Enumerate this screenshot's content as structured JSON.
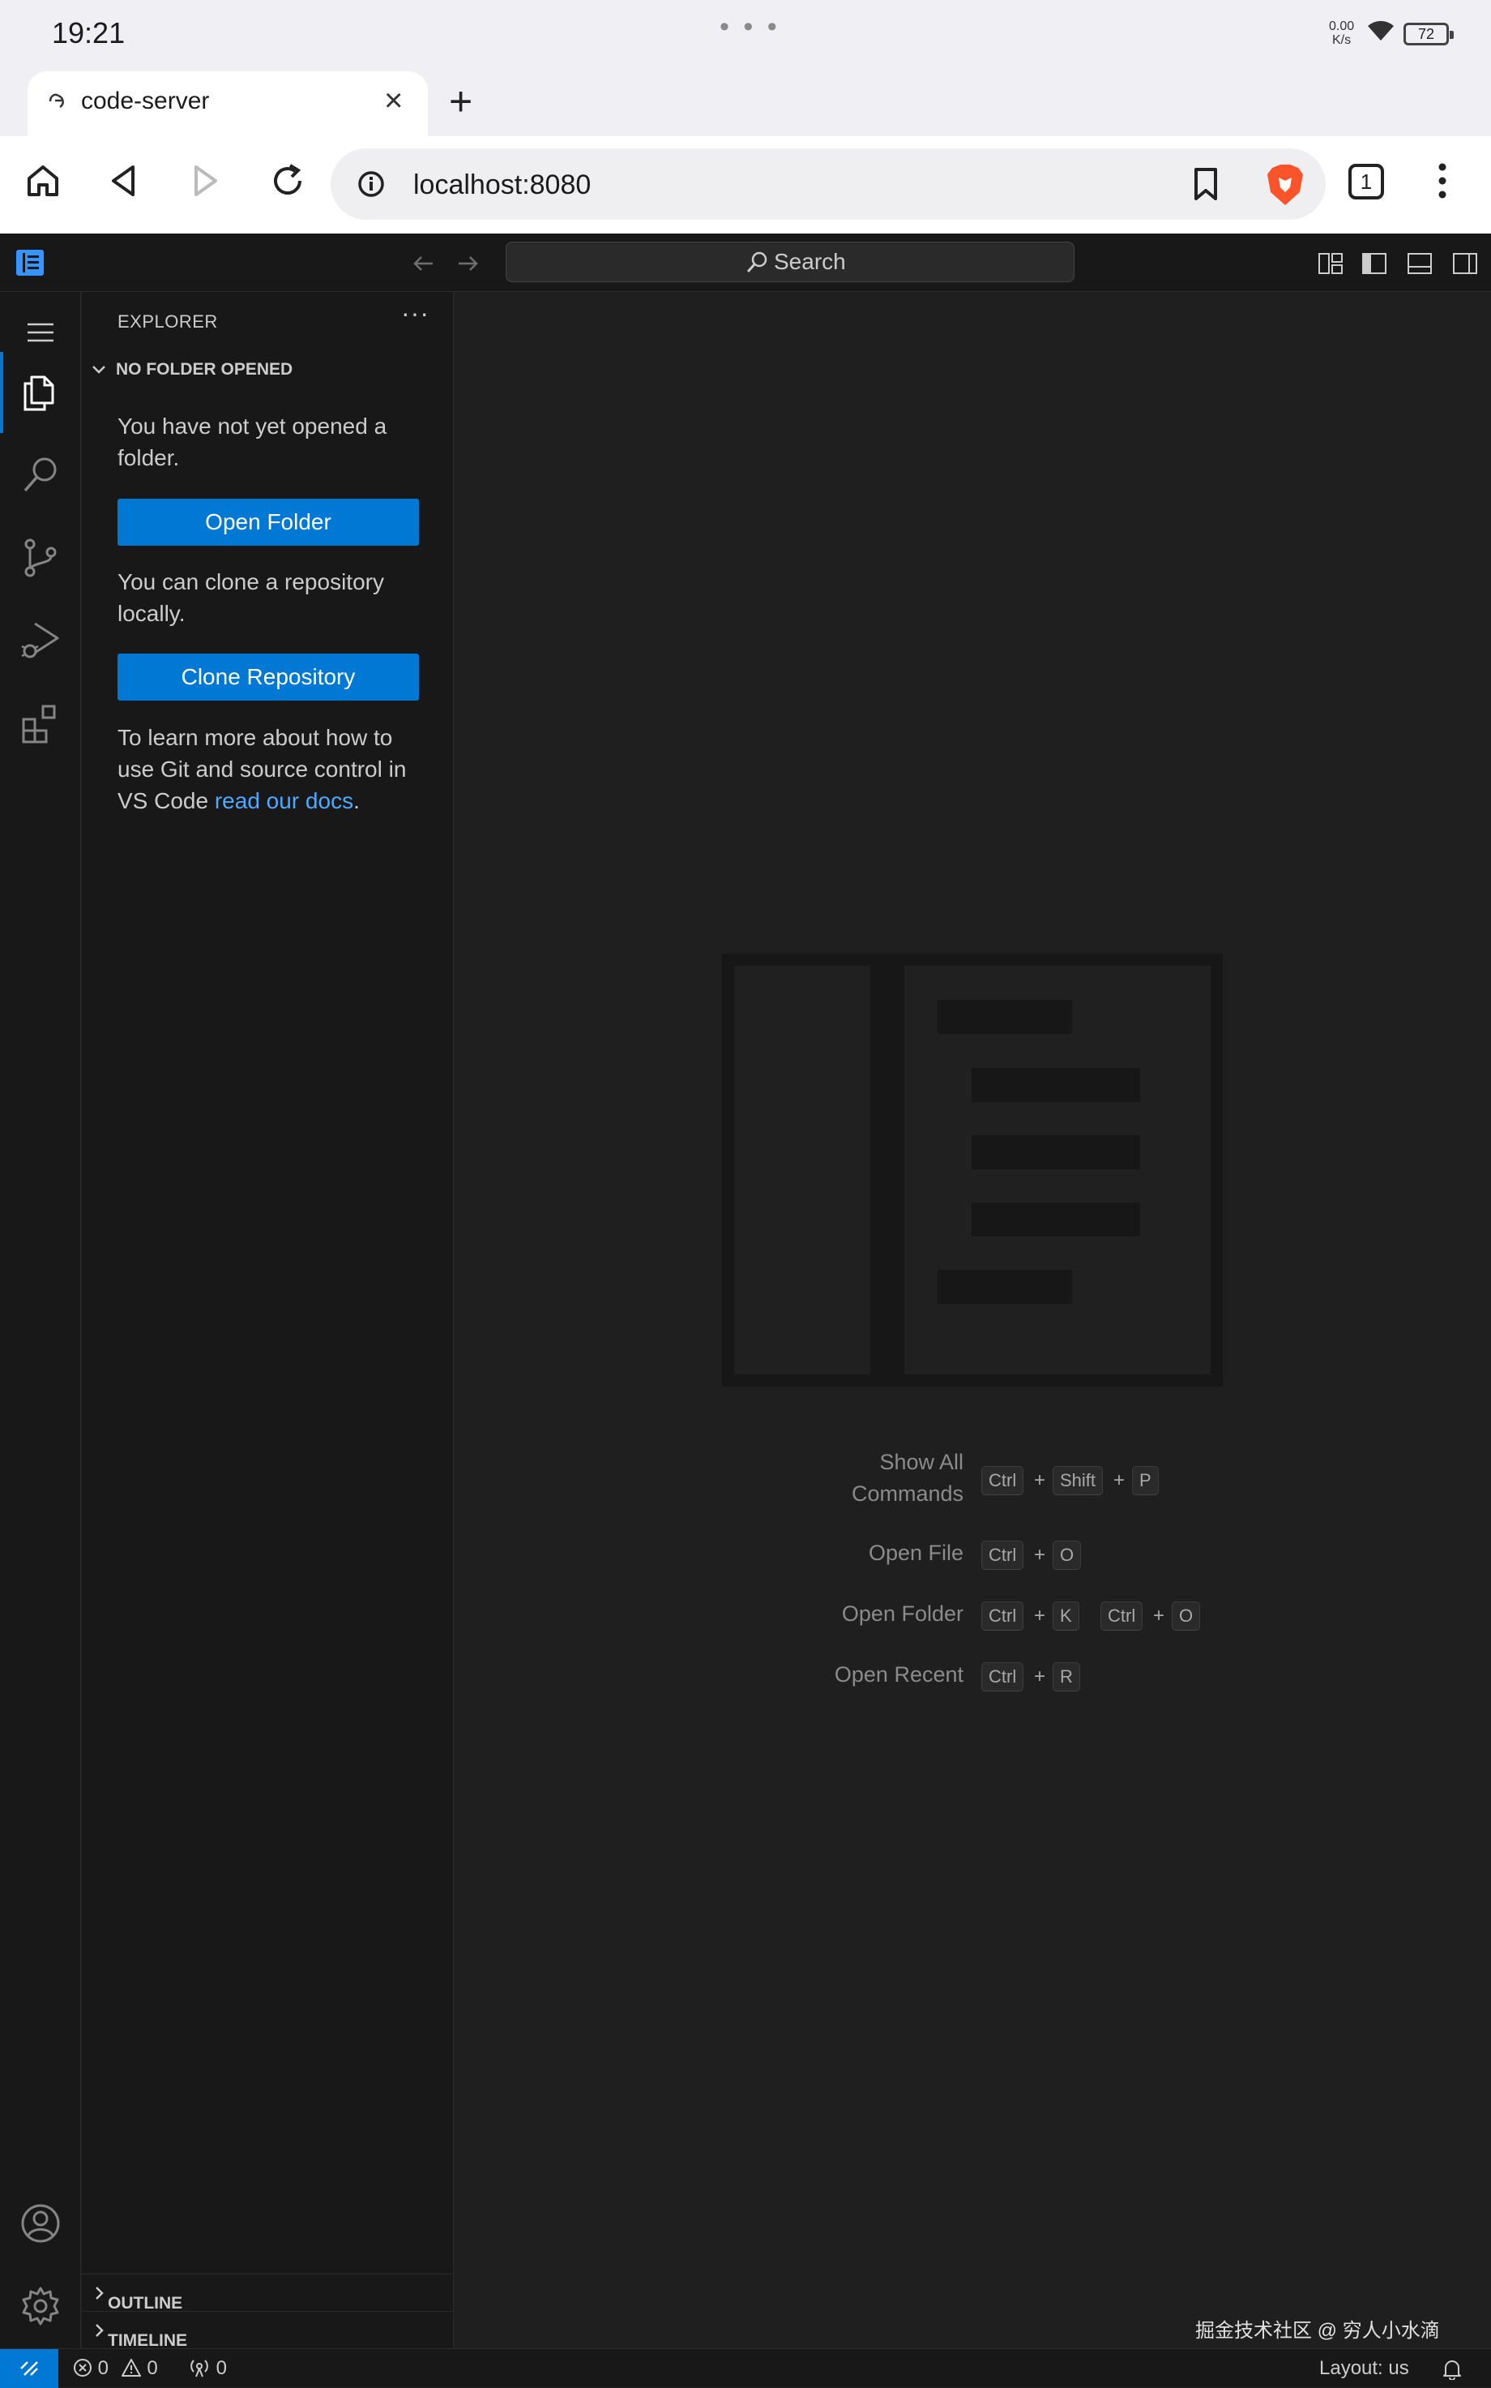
{
  "android_status": {
    "time": "19:21",
    "net_speed_value": "0.00",
    "net_speed_unit": "K/s",
    "battery": "72"
  },
  "browser": {
    "tab_title": "code-server",
    "url": "localhost:8080",
    "tab_count": "1"
  },
  "titlebar": {
    "search_placeholder": "Search"
  },
  "activity_bar": {
    "items": [
      "menu-icon",
      "explorer-icon",
      "search-icon",
      "source-control-icon",
      "run-debug-icon",
      "extensions-icon",
      "account-icon",
      "gear-icon"
    ],
    "active": "explorer"
  },
  "sidebar": {
    "header": "EXPLORER",
    "section_title": "NO FOLDER OPENED",
    "no_folder_text": "You have not yet opened a folder.",
    "open_folder_button": "Open Folder",
    "clone_text": "You can clone a repository locally.",
    "clone_button": "Clone Repository",
    "learn_text_prefix": "To learn more about how to use Git and source control in VS Code ",
    "learn_link": "read our docs",
    "learn_text_suffix": ".",
    "outline_label": "OUTLINE",
    "timeline_label": "TIMELINE"
  },
  "editor": {
    "shortcuts": [
      {
        "label_line1": "Show All",
        "label_line2": "Commands",
        "keys": [
          "Ctrl",
          "Shift",
          "P"
        ]
      },
      {
        "label_line1": "Open File",
        "keys": [
          "Ctrl",
          "O"
        ]
      },
      {
        "label_line1": "Open Folder",
        "keys": [
          "Ctrl",
          "K",
          "Ctrl",
          "O"
        ]
      },
      {
        "label_line1": "Open Recent",
        "keys": [
          "Ctrl",
          "R"
        ]
      }
    ],
    "plus": "+",
    "credit": "掘金技术社区 @ 穷人小水滴"
  },
  "statusbar": {
    "errors": "0",
    "warnings": "0",
    "ports": "0",
    "layout": "Layout: us"
  },
  "colors": {
    "accent": "#0078d4",
    "link": "#4daafc",
    "sidebar_bg": "#181818",
    "editor_bg": "#1f1f1f"
  }
}
